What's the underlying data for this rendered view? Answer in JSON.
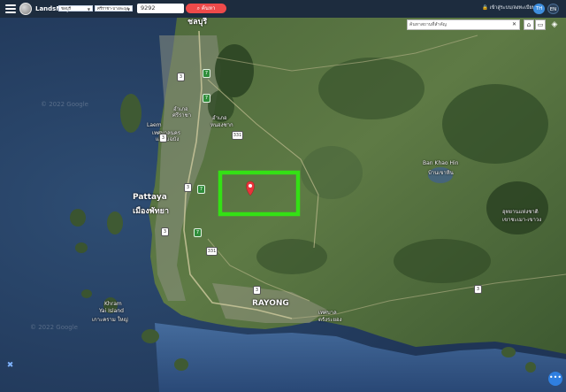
{
  "topbar": {
    "brand": "LandsMaps",
    "province_select": "ชลบุรี",
    "district_select": "ศรีราชา-บางละมุง",
    "parcel_value": "9292",
    "search_label": "ค้นหา",
    "login_label": "เข้าสู่ระบบ/ลงทะเบียน",
    "lang_th": "TH",
    "lang_en": "EN"
  },
  "map_search": {
    "placeholder": "ค้นหาสถานที่สำคัญ"
  },
  "map": {
    "places": [
      {
        "label": "ชลบุรี",
        "size": "big"
      },
      {
        "label": "Laem",
        "size": "small"
      },
      {
        "label": "อำเภอ",
        "size": "small"
      },
      {
        "label": "ศรีราชา",
        "size": "small"
      },
      {
        "label": "อำเภอ",
        "size": "small"
      },
      {
        "label": "หนองซาก",
        "size": "small"
      },
      {
        "label": "เทศบาลนคร",
        "size": "small"
      },
      {
        "label": "แหลมฉบัง",
        "size": "small"
      },
      {
        "label": "Pattaya",
        "size": "big"
      },
      {
        "label": "เมืองพัทยา",
        "size": "big"
      },
      {
        "label": "Ban Khao Hin",
        "size": "small"
      },
      {
        "label": "บ้านเขาหิน",
        "size": "small"
      },
      {
        "label": "อุทยานแห่งชาติ",
        "size": "small"
      },
      {
        "label": "เขาชะเมา-เขาวง",
        "size": "small"
      },
      {
        "label": "RAYONG",
        "size": "big"
      },
      {
        "label": "เทศบาล",
        "size": "small"
      },
      {
        "label": "ตรังระยอง",
        "size": "small"
      },
      {
        "label": "Khram",
        "size": "small"
      },
      {
        "label": "Yai Island",
        "size": "small"
      },
      {
        "label": "เกาะคราม ใหญ่",
        "size": "small"
      }
    ],
    "watermarks": [
      "© 2022 Google",
      "© 2022 Google"
    ],
    "road_shields": [
      {
        "label": "3",
        "color": "white"
      },
      {
        "label": "7",
        "color": "green"
      },
      {
        "label": "7",
        "color": "green"
      },
      {
        "label": "3",
        "color": "white"
      },
      {
        "label": "331",
        "color": "white"
      },
      {
        "label": "3",
        "color": "white"
      },
      {
        "label": "7",
        "color": "green"
      },
      {
        "label": "7",
        "color": "green"
      },
      {
        "label": "3",
        "color": "white"
      },
      {
        "label": "331",
        "color": "white"
      },
      {
        "label": "3",
        "color": "white"
      },
      {
        "label": "3",
        "color": "white"
      }
    ],
    "highlight_color": "#34e015",
    "marker_color": "#e8333a"
  }
}
